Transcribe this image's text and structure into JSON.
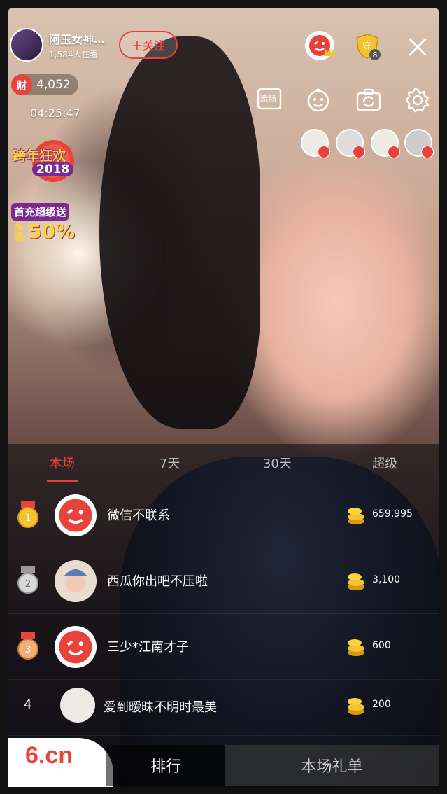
{
  "host": {
    "name": "阿玉女神…",
    "viewers": "1,584人在看"
  },
  "follow_label": "＋关注",
  "guard_count": "8",
  "wealth": {
    "tag": "财",
    "value": "4,052"
  },
  "timer": "04:25:47",
  "promo": {
    "newyear_line1": "跨年狂欢",
    "newyear_line2": "2018",
    "recharge_line1": "首充超级送",
    "recharge_line2": "多送",
    "recharge_pct": "50%"
  },
  "tools": {
    "live_label": "流畅"
  },
  "tabs": [
    "本场",
    "7天",
    "30天",
    "超级"
  ],
  "ranking": [
    {
      "rank": "1",
      "name": "微信不联系",
      "value": "659,995"
    },
    {
      "rank": "2",
      "name": "西瓜你出吧不压啦",
      "value": "3,100"
    },
    {
      "rank": "3",
      "name": "三少*江南才子",
      "value": "600"
    },
    {
      "rank": "4",
      "name": "爱到暧昧不明时最美",
      "value": "200"
    }
  ],
  "bottom": {
    "logo": "6.cn",
    "rank_tab": "排行",
    "gift_tab": "本场礼单"
  },
  "colors": {
    "accent": "#e8433b",
    "gold": "#f5c230"
  }
}
